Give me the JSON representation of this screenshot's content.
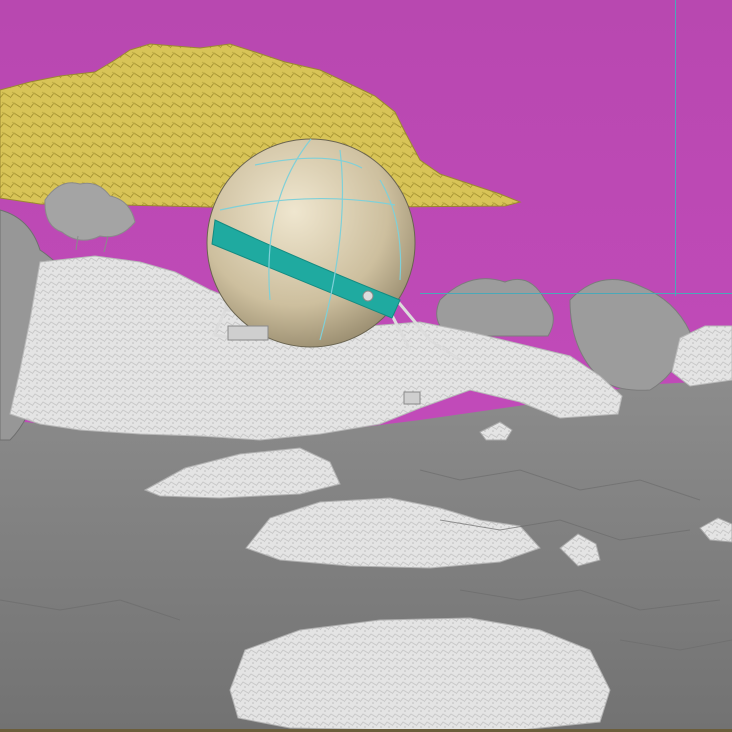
{
  "viewport": {
    "background_color": "#c245b6",
    "ground_color": "#7e7e7e",
    "rock_color": "#e6e6e6",
    "mountain_color": "#d8c457",
    "sphere_color": "#cdbf9e",
    "stripe_color": "#1faaa0",
    "wire_color": "#7fd0d8",
    "guide_color": "#4aa8b8"
  },
  "objects": [
    {
      "name": "mountain",
      "icon": "mountain-mesh"
    },
    {
      "name": "pod",
      "icon": "sphere-mesh"
    },
    {
      "name": "terrain",
      "icon": "terrain-mesh"
    },
    {
      "name": "rocks",
      "icon": "rock-mesh"
    },
    {
      "name": "shrubs",
      "icon": "tree-mesh"
    }
  ]
}
